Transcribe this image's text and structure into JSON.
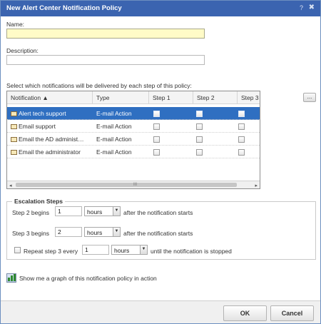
{
  "window": {
    "title": "New Alert Center Notification Policy",
    "help": "?",
    "close": "✖"
  },
  "name_field": {
    "label": "Name:",
    "value": ""
  },
  "description_field": {
    "label": "Description:",
    "value": ""
  },
  "instructions": "Select which notifications will be delivered by each step of this policy:",
  "grid": {
    "columns": [
      "Notification ▲",
      "Type",
      "Step 1",
      "Step 2",
      "Step 3"
    ],
    "rows": [
      {
        "notification": "Alert tech support",
        "type": "E-mail Action",
        "selected": true
      },
      {
        "notification": "Email support",
        "type": "E-mail Action",
        "selected": false
      },
      {
        "notification": "Email the AD administ…",
        "type": "E-mail Action",
        "selected": false
      },
      {
        "notification": "Email the administrator",
        "type": "E-mail Action",
        "selected": false
      }
    ],
    "scroll_left": "◂",
    "scroll_right": "▸",
    "scroll_grip": "III"
  },
  "more_button": "...",
  "escalation": {
    "legend": "Escalation Steps",
    "step2": {
      "label": "Step 2 begins",
      "value": "1",
      "unit": "hours",
      "suffix": "after the notification starts"
    },
    "step3": {
      "label": "Step 3 begins",
      "value": "2",
      "unit": "hours",
      "suffix": "after the notification starts"
    },
    "repeat": {
      "label": "Repeat step 3 every",
      "value": "1",
      "unit": "hours",
      "suffix": "until the notification is stopped",
      "checked": false
    }
  },
  "graph_link": "Show me a graph of this notification policy in action",
  "buttons": {
    "ok": "OK",
    "cancel": "Cancel"
  },
  "colors": {
    "titlebar": "#3b64b0",
    "selection": "#2f6fc1",
    "name_field_bg": "#fffbc7"
  }
}
